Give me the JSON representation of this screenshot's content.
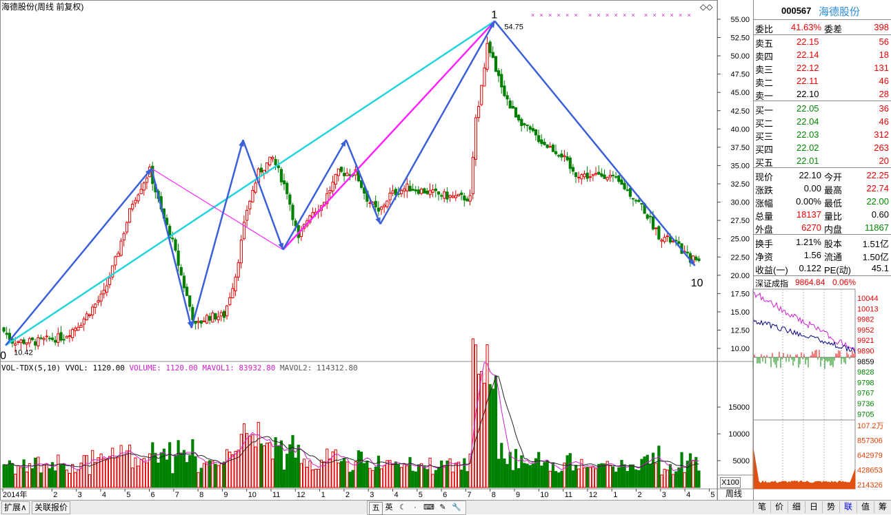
{
  "header": {
    "title": "海德股份(周线 前复权)"
  },
  "chart_data": [
    {
      "type": "candlestick",
      "title": "海德股份(周线 前复权)",
      "y_ticks": [
        "55.00",
        "52.50",
        "50.00",
        "47.50",
        "45.00",
        "42.50",
        "40.00",
        "37.50",
        "35.00",
        "32.50",
        "30.00",
        "27.50",
        "25.00",
        "22.50",
        "20.00",
        "17.50",
        "15.00",
        "12.50",
        "10.00"
      ],
      "ylim": [
        8.5,
        56.5
      ],
      "x_ticks": [
        "2014年",
        "2",
        "3",
        "4",
        "5",
        "6",
        "7",
        "8",
        "9",
        "10",
        "11",
        "12",
        "1",
        "2",
        "3",
        "4",
        "5",
        "6",
        "7",
        "8",
        "9",
        "10",
        "11",
        "12",
        "1",
        "2",
        "3",
        "4",
        "5"
      ],
      "wave_labels": [
        "0",
        "1",
        "10"
      ],
      "price_annotations": [
        "54.75",
        "10.42"
      ],
      "waves": [
        {
          "from_label": "0",
          "from_price": 10.42,
          "to_label": "1",
          "to_price": 54.75
        },
        {
          "from_label": "1",
          "from_price": 54.75,
          "to_label": "10",
          "to_price": 21.5
        }
      ]
    },
    {
      "type": "bar",
      "title": "VOL-TDX(5,10)",
      "legend": [
        {
          "label": "VVOL: 1120.00"
        },
        {
          "label": "VOLUME: 1120.00"
        },
        {
          "label": "MAVOL1: 83932.80"
        },
        {
          "label": "MAVOL2: 114312.80"
        }
      ],
      "y_ticks": [
        "15000",
        "10000",
        "5000"
      ],
      "unit": "X100",
      "period": "周线"
    },
    {
      "type": "line",
      "title": "深证成指",
      "value": "9864.84",
      "change": "0.06%",
      "y_ticks": [
        "10044",
        "10013",
        "9982",
        "9952",
        "9921",
        "9890",
        "9859",
        "9828",
        "9798",
        "9767",
        "9736",
        "9705"
      ],
      "vol_ticks": [
        "107.2万",
        "857306",
        "642979",
        "428653",
        "214326"
      ]
    }
  ],
  "quote": {
    "code": "000567",
    "name": "海德股份",
    "weibi": {
      "label": "委比",
      "value": "41.63%",
      "diff_label": "委差",
      "diff": "398"
    },
    "sell": [
      {
        "label": "卖五",
        "price": "22.15",
        "vol": "56"
      },
      {
        "label": "卖四",
        "price": "22.14",
        "vol": "18"
      },
      {
        "label": "卖三",
        "price": "22.12",
        "vol": "131"
      },
      {
        "label": "卖二",
        "price": "22.11",
        "vol": "46"
      },
      {
        "label": "卖一",
        "price": "22.10",
        "vol": "28"
      }
    ],
    "buy": [
      {
        "label": "买一",
        "price": "22.05",
        "vol": "36"
      },
      {
        "label": "买二",
        "price": "22.04",
        "vol": "46"
      },
      {
        "label": "买三",
        "price": "22.03",
        "vol": "312"
      },
      {
        "label": "买四",
        "price": "22.02",
        "vol": "263"
      },
      {
        "label": "买五",
        "price": "22.01",
        "vol": "20"
      }
    ],
    "stats": [
      {
        "l1": "现价",
        "v1": "22.10",
        "l2": "今开",
        "v2": "22.25"
      },
      {
        "l1": "涨跌",
        "v1": "0.00",
        "l2": "最高",
        "v2": "22.74"
      },
      {
        "l1": "涨幅",
        "v1": "0.00%",
        "l2": "最低",
        "v2": "22.00"
      },
      {
        "l1": "总量",
        "v1": "18137",
        "l2": "量比",
        "v2": "0.60"
      },
      {
        "l1": "外盘",
        "v1": "6270",
        "l2": "内盘",
        "v2": "11867"
      }
    ],
    "fund": [
      {
        "l1": "换手",
        "v1": "1.21%",
        "l2": "股本",
        "v2": "1.51亿"
      },
      {
        "l1": "净资",
        "v1": "1.56",
        "l2": "流通",
        "v2": "1.50亿"
      },
      {
        "l1": "收益(一)",
        "v1": "0.122",
        "l2": "PE(动)",
        "v2": "45.1"
      }
    ]
  },
  "bottom": {
    "tabs": [
      "扩展∧",
      "关联报价"
    ],
    "right_tabs": [
      "笔",
      "价",
      "细",
      "日",
      "势",
      "联",
      "值",
      "筹"
    ],
    "tools": [
      "五",
      "英",
      "☾",
      "·",
      "⌨",
      "✎",
      "🔧"
    ]
  },
  "colors": {
    "up": "#e00000",
    "down": "#008000",
    "blue_wave": "#3a5fd9",
    "cyan_line": "#22d4dc",
    "magenta_line": "#ff22ff",
    "mavol2": "#222222"
  }
}
